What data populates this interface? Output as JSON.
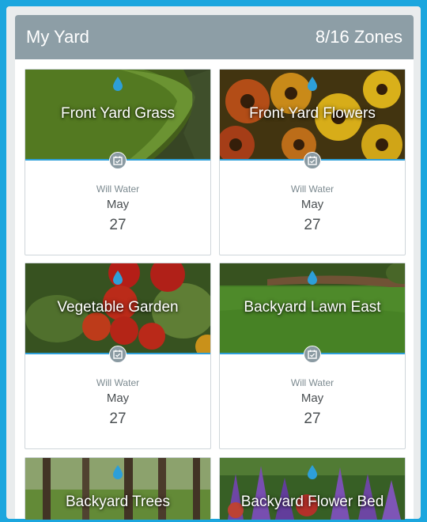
{
  "header": {
    "title": "My Yard",
    "zones": "8/16 Zones"
  },
  "zones": [
    {
      "name": "Front Yard Grass",
      "status": "Will Water",
      "month": "May",
      "day": "27"
    },
    {
      "name": "Front Yard Flowers",
      "status": "Will Water",
      "month": "May",
      "day": "27"
    },
    {
      "name": "Vegetable Garden",
      "status": "Will Water",
      "month": "May",
      "day": "27"
    },
    {
      "name": "Backyard Lawn East",
      "status": "Will Water",
      "month": "May",
      "day": "27"
    },
    {
      "name": "Backyard Trees",
      "status": "",
      "month": "",
      "day": ""
    },
    {
      "name": "Backyard Flower Bed",
      "status": "",
      "month": "",
      "day": ""
    }
  ],
  "colors": {
    "background": "#1ba6de",
    "header": "#8d9ea6",
    "accent": "#2d9fd9"
  }
}
